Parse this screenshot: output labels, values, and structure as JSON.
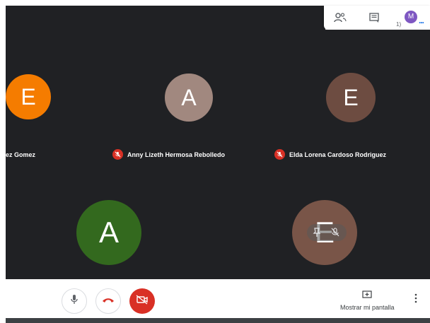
{
  "top_panel": {
    "people_icon": "people-icon",
    "chat_icon": "chat-icon",
    "count": "1)",
    "avatar_initial": "M",
    "more": "..."
  },
  "participants": [
    {
      "initial": "E",
      "name": "ez Gomez",
      "avatar_color": "#f57c00",
      "muted": false
    },
    {
      "initial": "A",
      "name": "Anny Lizeth Hermosa Rebolledo",
      "avatar_color": "#a1887f",
      "muted": true
    },
    {
      "initial": "E",
      "name": "Elda Lorena Cardoso Rodriguez",
      "avatar_color": "#6d4c41",
      "muted": true
    },
    {
      "initial": "A",
      "name": "",
      "avatar_color": "#33691e",
      "muted": false
    },
    {
      "initial": "E",
      "name": "",
      "avatar_color": "#795548",
      "muted": false
    }
  ],
  "controls": {
    "mic_icon": "mic-icon",
    "hangup_icon": "hangup-icon",
    "camera_off_icon": "camera-off-icon",
    "present_icon": "present-screen-icon",
    "present_label": "Mostrar mi pantalla",
    "more_icon": "more-vert-icon"
  },
  "colors": {
    "stage_bg": "#202124",
    "muted_red": "#d93025",
    "accent_blue": "#1a73e8"
  }
}
